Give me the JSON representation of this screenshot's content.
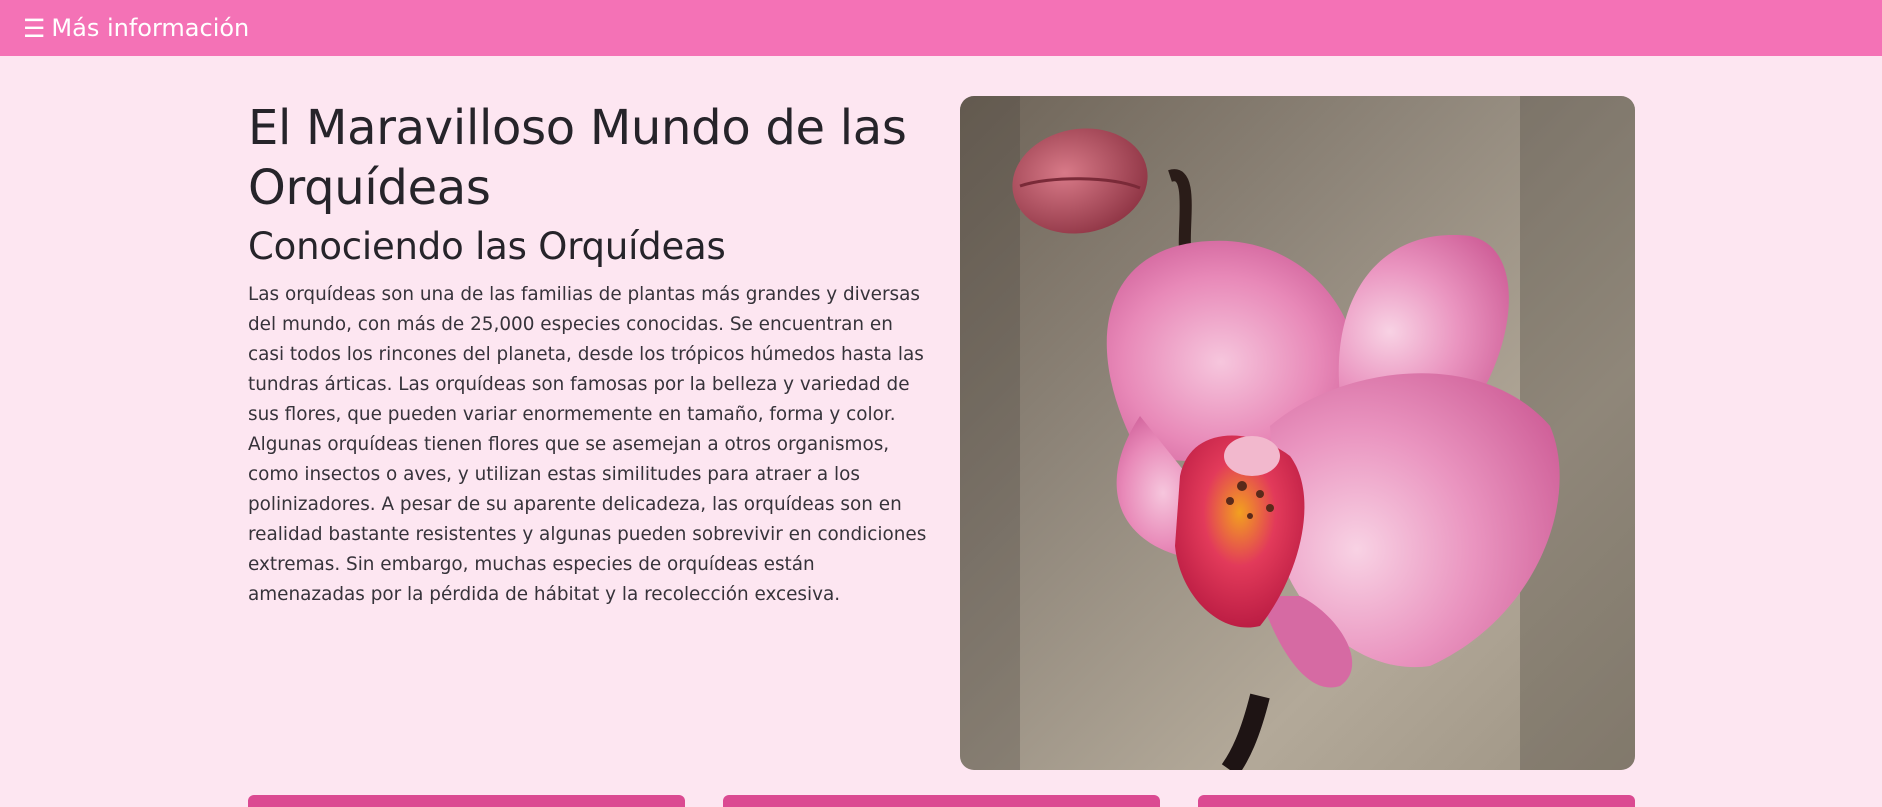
{
  "navbar": {
    "menu_icon": "☰",
    "menu_label": "Más información",
    "bg_color": "#f472b6"
  },
  "main": {
    "title": "El Maravilloso Mundo de las Orquídeas",
    "subtitle": "Conociendo las Orquídeas",
    "paragraph": "Las orquídeas son una de las familias de plantas más grandes y diversas del mundo, con más de 25,000 especies conocidas. Se encuentran en casi todos los rincones del planeta, desde los trópicos húmedos hasta las tundras árticas. Las orquídeas son famosas por la belleza y variedad de sus flores, que pueden variar enormemente en tamaño, forma y color. Algunas orquídeas tienen flores que se asemejan a otros organismos, como insectos o aves, y utilizan estas similitudes para atraer a los polinizadores. A pesar de su aparente delicadeza, las orquídeas son en realidad bastante resistentes y algunas pueden sobrevivir en condiciones extremas. Sin embargo, muchas especies de orquídeas están amenazadas por la pérdida de hábitat y la recolección excesiva."
  },
  "image": {
    "icon": "orchid-photo"
  },
  "colors": {
    "page_bg": "#fde6f1",
    "accent": "#f472b6",
    "card_accent": "#db4a92"
  },
  "cards": [
    {
      "icon": "card"
    },
    {
      "icon": "card"
    },
    {
      "icon": "card"
    }
  ]
}
